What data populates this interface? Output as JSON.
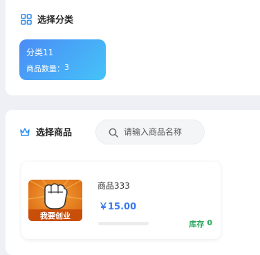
{
  "category_section": {
    "title": "选择分类",
    "icon": "category-grid-icon",
    "categories": [
      {
        "name": "分类11",
        "count_label": "商品数量：",
        "count": "3"
      }
    ]
  },
  "goods_section": {
    "title": "选择商品",
    "icon": "crown-icon",
    "search": {
      "placeholder": "请输入商品名称",
      "value": ""
    },
    "goods": [
      {
        "name": "商品333",
        "price": "￥15.00",
        "stock_label": "库存",
        "stock": "0",
        "stock_level": 0,
        "image_caption": "我要创业"
      }
    ]
  },
  "colors": {
    "accent_blue": "#3b7bf0",
    "stock_green": "#2aa860",
    "card_gradient_start": "#4a8cf6",
    "card_gradient_end": "#46c3f8"
  }
}
